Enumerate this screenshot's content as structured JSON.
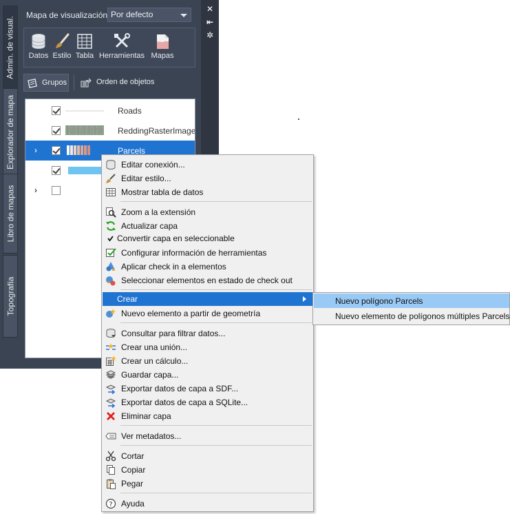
{
  "left_tabs": [
    {
      "label": "Admin. de visual.",
      "active": true
    },
    {
      "label": "Explorador de mapa",
      "active": false
    },
    {
      "label": "Libro de mapas",
      "active": false
    },
    {
      "label": "Topografía",
      "active": false
    }
  ],
  "right_strip": {
    "close_icon": "close-icon",
    "autohide_icon": "autohide-icon",
    "properties_icon": "properties-icon"
  },
  "display_map": {
    "label": "Mapa de visualización:",
    "value": "Por defecto"
  },
  "toolbar": [
    {
      "label": "Datos",
      "icon": "database-icon"
    },
    {
      "label": "Estilo",
      "icon": "paintbrush-icon"
    },
    {
      "label": "Tabla",
      "icon": "table-icon"
    },
    {
      "label": "Herramientas",
      "icon": "tools-icon"
    },
    {
      "label": "Mapas",
      "icon": "maps-icon"
    }
  ],
  "view_buttons": {
    "groups": "Grupos",
    "draw_order": "Orden de objetos"
  },
  "layers": [
    {
      "name": "Roads",
      "checked": true,
      "expandable": false,
      "selected": false
    },
    {
      "name": "ReddingRasterImage",
      "checked": true,
      "expandable": false,
      "selected": false
    },
    {
      "name": "Parcels",
      "checked": true,
      "expandable": true,
      "selected": true
    },
    {
      "name": "",
      "checked": true,
      "expandable": false,
      "selected": false
    },
    {
      "name": "",
      "checked": false,
      "expandable": true,
      "selected": false
    }
  ],
  "context_menu": {
    "items": [
      "Editar conexión...",
      "Editar estilo...",
      "Mostrar tabla de datos",
      "Zoom a la extensión",
      "Actualizar capa",
      "Convertir capa en seleccionable",
      "Configurar información de herramientas",
      "Aplicar check in a elementos",
      "Seleccionar elementos en estado de check out",
      "Crear",
      "Nuevo elemento a partir de geometría",
      "Consultar para filtrar datos...",
      "Crear una unión...",
      "Crear un cálculo...",
      "Guardar capa...",
      "Exportar datos de capa a SDF...",
      "Exportar datos de capa a SQLite...",
      "Eliminar capa",
      "Ver metadatos...",
      "Cortar",
      "Copiar",
      "Pegar",
      "Ayuda"
    ]
  },
  "submenu": {
    "items": [
      "Nuevo polígono Parcels",
      "Nuevo elemento de polígonos múltiples Parcels"
    ]
  },
  "colors": {
    "selection": "#1f73d1",
    "submenu_hover": "#99c9f5",
    "panel_bg": "#3b4453"
  }
}
